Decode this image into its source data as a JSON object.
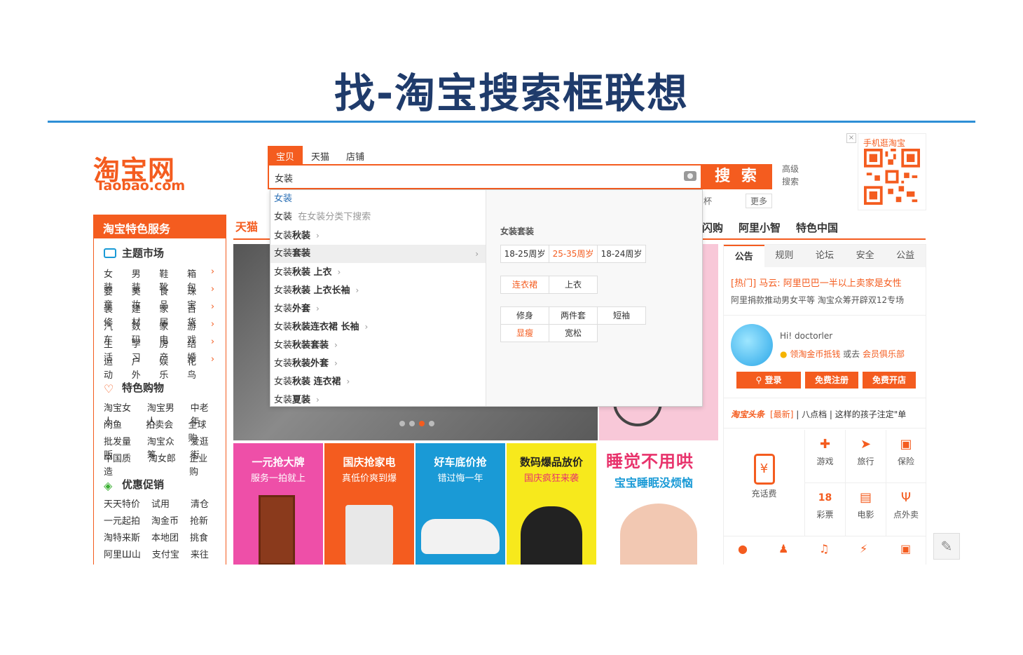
{
  "slide": {
    "title": "找-淘宝搜索框联想"
  },
  "logo": {
    "cn": "淘宝网",
    "en": "Taobao.com"
  },
  "search": {
    "tabs": [
      "宝贝",
      "天猫",
      "店铺"
    ],
    "query": "女装",
    "button": "搜 索",
    "advanced_1": "高级",
    "advanced_2": "搜索",
    "hint_fragment": "杯",
    "more": "更多"
  },
  "suggestions": {
    "items": [
      {
        "a": "女装",
        "b": "",
        "style": "blue"
      },
      {
        "a": "女装",
        "b": "在女装分类下搜索",
        "style": "grey"
      },
      {
        "a": "女装",
        "b": "秋装",
        "style": "chev"
      },
      {
        "a": "女装",
        "b": "套装",
        "style": "hl"
      },
      {
        "a": "女装",
        "b": "秋装 上衣",
        "style": "chev"
      },
      {
        "a": "女装",
        "b": "秋装 上衣长袖",
        "style": "chev"
      },
      {
        "a": "女装",
        "b": "外套",
        "style": "chev"
      },
      {
        "a": "女装",
        "b": "秋装连衣裙 长袖",
        "style": "chev"
      },
      {
        "a": "女装",
        "b": "秋装套装",
        "style": "chev"
      },
      {
        "a": "女装",
        "b": "秋装外套",
        "style": "chev"
      },
      {
        "a": "女装",
        "b": "秋装 连衣裙",
        "style": "chev"
      },
      {
        "a": "女装",
        "b": "夏装",
        "style": "chev"
      }
    ],
    "detail_title": "女装套装",
    "age_chips": [
      "18-25周岁",
      "25-35周岁",
      "18-24周岁"
    ],
    "type_chips": [
      "连衣裙",
      "上衣"
    ],
    "style_chips": [
      "修身",
      "两件套",
      "短袖",
      "显瘦",
      "宽松"
    ]
  },
  "qr": {
    "label": "手机逛淘宝",
    "close": "×"
  },
  "sidebar": {
    "header": "淘宝特色服务",
    "sections": [
      {
        "title": "主题市场",
        "rows": [
          [
            "女装",
            "男装",
            "鞋靴",
            "箱包"
          ],
          [
            "婴童",
            "美妆",
            "食品",
            "珠宝"
          ],
          [
            "装修",
            "建材",
            "家居",
            "百货"
          ],
          [
            "汽车",
            "数码",
            "家电",
            "游戏"
          ],
          [
            "生活",
            "学习",
            "房产",
            "结婚"
          ],
          [
            "运动",
            "户外",
            "娱乐",
            "花鸟"
          ]
        ]
      },
      {
        "title": "特色购物",
        "rows": [
          [
            "淘宝女人",
            "淘宝男人",
            "中老年"
          ],
          [
            "闲鱼",
            "拍卖会",
            "全球购"
          ],
          [
            "批发量贩",
            "淘宝众筹",
            "爱逛街"
          ],
          [
            "中国质造",
            "淘女郎",
            "企业购"
          ]
        ]
      },
      {
        "title": "优惠促销",
        "rows": [
          [
            "天天特价",
            "试用",
            "清仓"
          ],
          [
            "一元起拍",
            "淘金币",
            "抢新"
          ],
          [
            "淘特来斯",
            "本地团",
            "挑食"
          ],
          [
            "阿里Ш山",
            "支付宝",
            "来往"
          ]
        ]
      }
    ],
    "arrow": "›"
  },
  "nav": {
    "tmall": "天猫",
    "right": [
      "闪购",
      "阿里小智",
      "特色中国"
    ]
  },
  "tiles": [
    {
      "t1": "一元抢大牌",
      "t2": "服务一拍就上",
      "bg": "#ee4fa8"
    },
    {
      "t1": "国庆抢家电",
      "t2": "真低价爽到爆",
      "bg": "#f45c1f"
    },
    {
      "t1": "好车底价抢",
      "t2": "错过悔一年",
      "bg": "#1a9ad6"
    },
    {
      "t1": "数码爆品放价",
      "t2": "国庆疯狂来袭",
      "bg": "#f7e91c"
    }
  ],
  "sleep": {
    "h1": "睡觉不用哄",
    "h2": "宝宝睡眠没烦恼"
  },
  "panel": {
    "tabs": [
      "公告",
      "规则",
      "论坛",
      "安全",
      "公益"
    ],
    "hot": "[热门] 马云: 阿里巴巴一半以上卖家是女性",
    "hot2": "阿里捐款推动男女平等   淘宝众筹开辟双12专场",
    "hi": "Hi! doctorler",
    "coin_a": "领淘金币抵钱",
    "coin_b": " 或去 ",
    "coin_c": "会员俱乐部",
    "buttons": [
      "登录",
      "免费注册",
      "免费开店"
    ],
    "headline_logo": "淘宝头条",
    "headline_new": "[最新]",
    "headline_text": " | 八点档 | 这样的孩子注定\"单",
    "services": [
      {
        "label": "充话费",
        "icon": "¥"
      },
      {
        "label": "游戏",
        "icon": "✚"
      },
      {
        "label": "旅行",
        "icon": "➤"
      },
      {
        "label": "保险",
        "icon": "▣"
      },
      {
        "label": "彩票",
        "icon": "18"
      },
      {
        "label": "电影",
        "icon": "▤"
      },
      {
        "label": "点外卖",
        "icon": "Ψ"
      }
    ]
  }
}
